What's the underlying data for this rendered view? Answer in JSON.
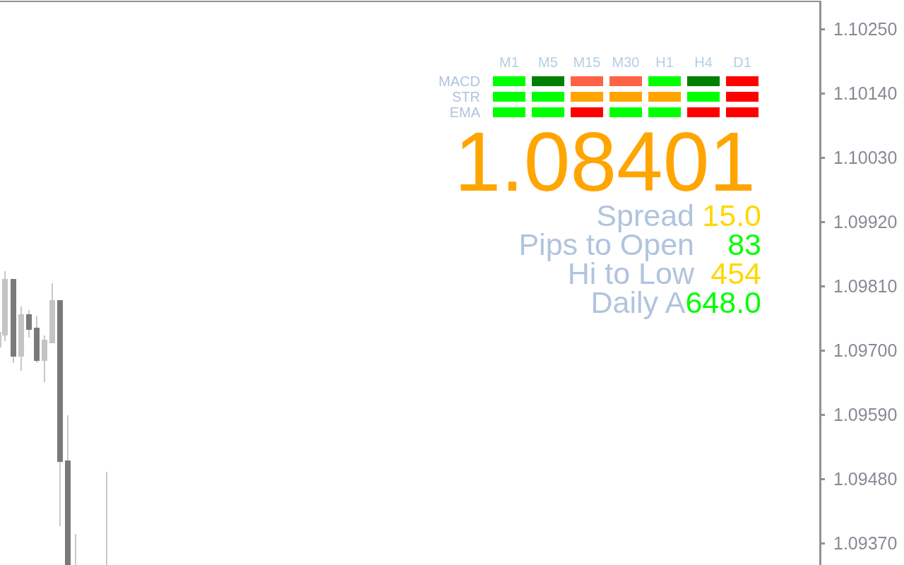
{
  "indicator_panel": {
    "timeframes": [
      "M1",
      "M5",
      "M15",
      "M30",
      "H1",
      "H4",
      "D1"
    ],
    "rows": [
      {
        "name": "MACD",
        "cells": [
          {
            "color": "#00ff00"
          },
          {
            "color": "#008000"
          },
          {
            "color": "#ff6347"
          },
          {
            "color": "#ff6347"
          },
          {
            "color": "#00ff00"
          },
          {
            "color": "#008000"
          },
          {
            "color": "#ff0000"
          }
        ]
      },
      {
        "name": "STR",
        "cells": [
          {
            "color": "#00ff00"
          },
          {
            "color": "#00ff00"
          },
          {
            "color": "#ffa500"
          },
          {
            "color": "#ffa500"
          },
          {
            "color": "#ffa500"
          },
          {
            "color": "#00ff00"
          },
          {
            "color": "#ff0000"
          }
        ]
      },
      {
        "name": "EMA",
        "cells": [
          {
            "color": "#00ff00"
          },
          {
            "color": "#00ff00"
          },
          {
            "color": "#ff0000"
          },
          {
            "color": "#00ff00"
          },
          {
            "color": "#00ff00"
          },
          {
            "color": "#ff0000"
          },
          {
            "color": "#ff0000"
          }
        ]
      }
    ]
  },
  "price": "1.08401",
  "stats": [
    {
      "label": "Spread",
      "value": "15.0",
      "color": "#ffd700"
    },
    {
      "label": "Pips to Open",
      "value": "83",
      "color": "#00ff00"
    },
    {
      "label": "Hi to Low",
      "value": "454",
      "color": "#ffd700"
    },
    {
      "label": "Daily A",
      "value": "648.0",
      "color": "#00ff00"
    }
  ],
  "price_axis": {
    "labels": [
      "1.10250",
      "1.10140",
      "1.10030",
      "1.09920",
      "1.09810",
      "1.09700",
      "1.09590",
      "1.09480",
      "1.09370"
    ]
  }
}
